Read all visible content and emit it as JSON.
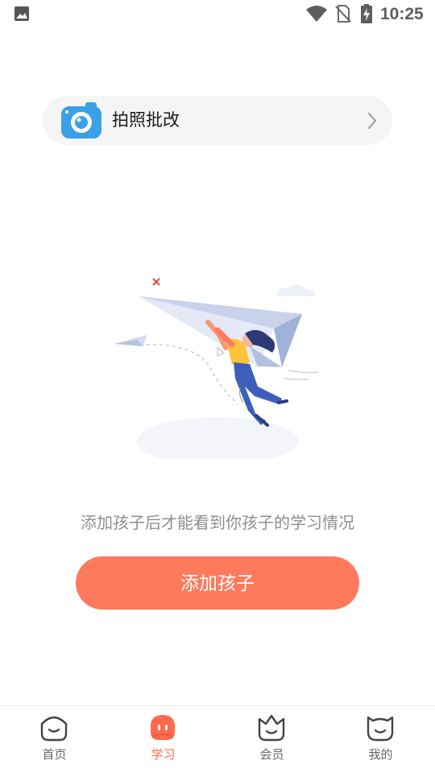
{
  "status_bar": {
    "time": "10:25",
    "icons": [
      "photo-icon",
      "wifi-icon",
      "no-sim-icon",
      "battery-charging-icon"
    ]
  },
  "feature_card": {
    "label": "拍照批改",
    "icon": "camera-icon",
    "accent_color": "#3aa0e8"
  },
  "empty_state": {
    "illustration": "paper-plane-girl-illustration",
    "hint": "添加孩子后才能看到你孩子的学习情况"
  },
  "primary_button": {
    "label": "添加孩子",
    "color": "#ff7a5d"
  },
  "bottom_nav": {
    "items": [
      {
        "label": "首页",
        "icon": "home-face-icon",
        "active": false
      },
      {
        "label": "学习",
        "icon": "study-face-icon",
        "active": true
      },
      {
        "label": "会员",
        "icon": "crown-face-icon",
        "active": false
      },
      {
        "label": "我的",
        "icon": "profile-face-icon",
        "active": false
      }
    ],
    "active_color": "#ff6a4c"
  }
}
